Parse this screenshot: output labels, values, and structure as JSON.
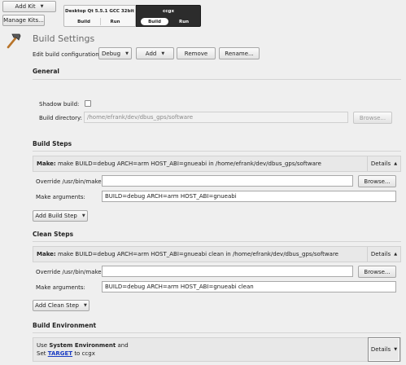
{
  "kit_buttons": {
    "add_kit": "Add Kit",
    "manage_kits": "Manage Kits..."
  },
  "targets": [
    {
      "name": "Desktop Qt 5.5.1 GCC 32bit",
      "build": "Build",
      "run": "Run"
    },
    {
      "name": "ccgx",
      "build": "Build",
      "run": "Run"
    }
  ],
  "page_title": "Build Settings",
  "config": {
    "label": "Edit build configuration:",
    "selected": "Debug",
    "add": "Add",
    "remove": "Remove",
    "rename": "Rename..."
  },
  "general": {
    "title": "General",
    "shadow_build_label": "Shadow build:",
    "build_dir_label": "Build directory:",
    "build_dir_value": "/home/efrank/dev/dbus_gps/software",
    "browse": "Browse..."
  },
  "build_steps": {
    "title": "Build Steps",
    "make_label": "Make:",
    "make_summary": "make BUILD=debug ARCH=arm HOST_ABI=gnueabi in /home/efrank/dev/dbus_gps/software",
    "details": "Details",
    "override_label": "Override /usr/bin/make:",
    "override_value": "",
    "browse": "Browse...",
    "args_label": "Make arguments:",
    "args_value": "BUILD=debug ARCH=arm HOST_ABI=gnueabi",
    "add_step": "Add Build Step"
  },
  "clean_steps": {
    "title": "Clean Steps",
    "make_label": "Make:",
    "make_summary": "make BUILD=debug ARCH=arm HOST_ABI=gnueabi clean in /home/efrank/dev/dbus_gps/software",
    "details": "Details",
    "override_label": "Override /usr/bin/make:",
    "override_value": "",
    "browse": "Browse...",
    "args_label": "Make arguments:",
    "args_value": "BUILD=debug ARCH=arm HOST_ABI=gnueabi clean",
    "add_step": "Add Clean Step"
  },
  "build_env": {
    "title": "Build Environment",
    "use_text": "Use",
    "system_env": "System Environment",
    "and_text": "and",
    "set_text": "Set",
    "target_link": "TARGET",
    "to_text": "to ccgx",
    "details": "Details"
  },
  "colors": {
    "target_active_bg": "#2c2c2c",
    "link": "#1a3cc4"
  }
}
